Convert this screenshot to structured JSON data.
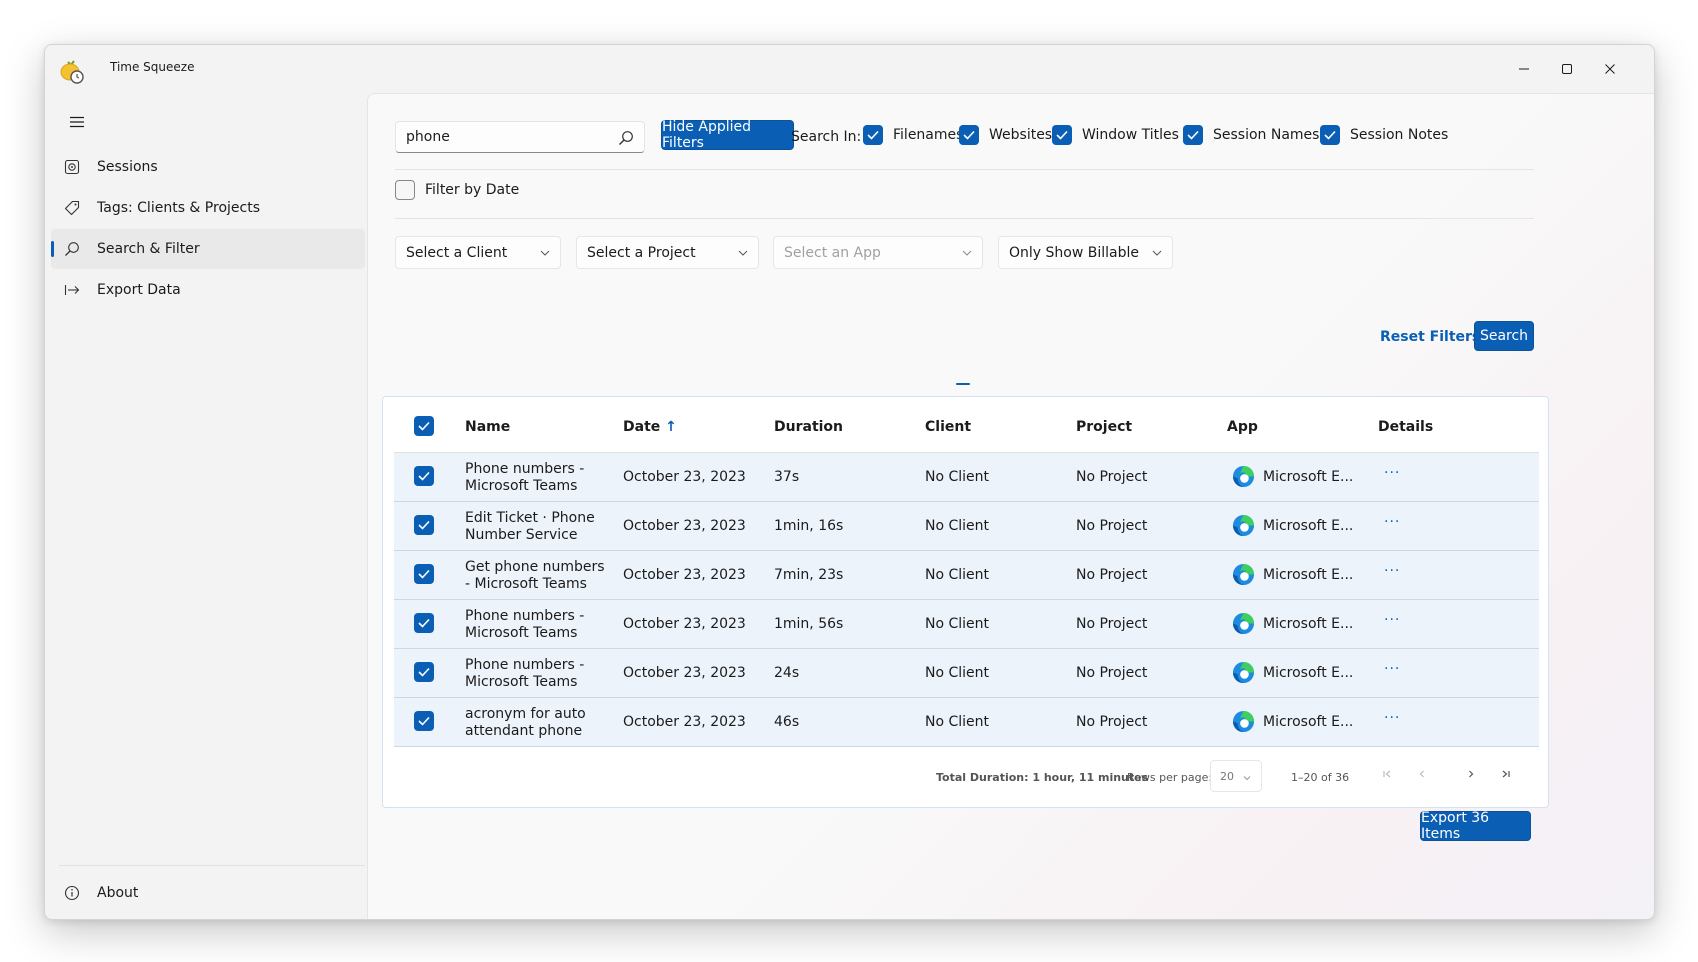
{
  "app": {
    "title": "Time Squeeze"
  },
  "nav": {
    "items": [
      {
        "label": "Sessions",
        "icon": "sessions-icon"
      },
      {
        "label": "Tags: Clients & Projects",
        "icon": "tag-icon"
      },
      {
        "label": "Search & Filter",
        "icon": "search-icon",
        "active": true
      },
      {
        "label": "Export Data",
        "icon": "export-icon"
      }
    ],
    "footer": {
      "label": "About",
      "icon": "info-icon"
    }
  },
  "filters": {
    "search_value": "phone",
    "hide_button": "Hide Applied Filters",
    "search_in_label": "Search In:",
    "search_in": [
      "Filenames",
      "Websites",
      "Window Titles",
      "Session Names",
      "Session Notes"
    ],
    "filter_by_date": "Filter by Date",
    "client_placeholder": "Select a Client",
    "project_placeholder": "Select a Project",
    "app_placeholder": "Select an App",
    "billable": "Only Show Billable",
    "reset": "Reset Filters",
    "search": "Search"
  },
  "table": {
    "columns": [
      "Name",
      "Date",
      "Duration",
      "Client",
      "Project",
      "App",
      "Details"
    ],
    "sort_indicator": "↑",
    "rows": [
      {
        "name": "Phone numbers - Microsoft Teams",
        "date": "October 23, 2023",
        "duration": "37s",
        "client": "No Client",
        "project": "No Project",
        "app": "Microsoft E...",
        "details": "···"
      },
      {
        "name": "Edit Ticket · Phone Number Service",
        "date": "October 23, 2023",
        "duration": "1min, 16s",
        "client": "No Client",
        "project": "No Project",
        "app": "Microsoft E...",
        "details": "···"
      },
      {
        "name": "Get phone numbers - Microsoft Teams",
        "date": "October 23, 2023",
        "duration": "7min, 23s",
        "client": "No Client",
        "project": "No Project",
        "app": "Microsoft E...",
        "details": "···"
      },
      {
        "name": "Phone numbers - Microsoft Teams",
        "date": "October 23, 2023",
        "duration": "1min, 56s",
        "client": "No Client",
        "project": "No Project",
        "app": "Microsoft E...",
        "details": "···"
      },
      {
        "name": "Phone numbers - Microsoft Teams",
        "date": "October 23, 2023",
        "duration": "24s",
        "client": "No Client",
        "project": "No Project",
        "app": "Microsoft E...",
        "details": "···"
      },
      {
        "name": "acronym for auto attendant phone",
        "date": "October 23, 2023",
        "duration": "46s",
        "client": "No Client",
        "project": "No Project",
        "app": "Microsoft E...",
        "details": "···"
      }
    ],
    "footer": {
      "total": "Total Duration: 1 hour, 11 minutes",
      "rows_per_page_label": "Rows per page:",
      "rows_per_page": "20",
      "range": "1–20 of 36"
    }
  },
  "export_button": "Export 36 Items",
  "colors": {
    "accent": "#0a5fb4",
    "row_bg": "#edf3fb"
  }
}
